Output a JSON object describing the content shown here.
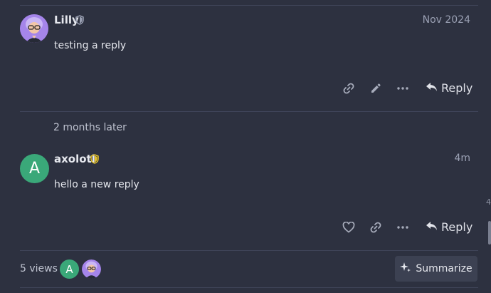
{
  "posts": [
    {
      "username": "Lilly",
      "date": "Nov 2024",
      "body": "testing a reply",
      "reply_label": "Reply",
      "badge_color": "#9aa0b3"
    },
    {
      "username": "axolotl",
      "avatar_letter": "A",
      "date": "4m",
      "body": "hello a new reply",
      "reply_label": "Reply",
      "badge_color": "#e6c229"
    }
  ],
  "time_gap": "2 months later",
  "footer": {
    "views": "5 views",
    "participant_letter": "A",
    "summarize_label": "Summarize"
  },
  "edge_char": "4",
  "colors": {
    "background": "#2d3140",
    "avatar_green": "#3aa879",
    "button_bg": "#3c4152"
  }
}
